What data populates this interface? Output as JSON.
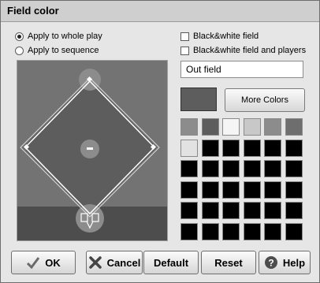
{
  "dialog": {
    "title": "Field color"
  },
  "apply": {
    "options": [
      {
        "label": "Apply to whole play",
        "selected": true
      },
      {
        "label": "Apply to sequence",
        "selected": false
      }
    ]
  },
  "options": {
    "bw_field": {
      "label": "Black&white field",
      "checked": false
    },
    "bw_field_players": {
      "label": "Black&white field and players",
      "checked": false
    }
  },
  "color_name": "Out field",
  "current_color": "#5d5d5d",
  "more_colors_label": "More Colors",
  "palette": [
    [
      "#8c8c8c",
      "#5d5d5d",
      "#f5f5f5",
      "#c8c8c8",
      "#8c8c8c",
      "#6e6e6e"
    ],
    [
      "#e2e2e2",
      "#000000",
      "#000000",
      "#000000",
      "#000000",
      "#000000"
    ],
    [
      "#000000",
      "#000000",
      "#000000",
      "#000000",
      "#000000",
      "#000000"
    ],
    [
      "#000000",
      "#000000",
      "#000000",
      "#000000",
      "#000000",
      "#000000"
    ],
    [
      "#000000",
      "#000000",
      "#000000",
      "#000000",
      "#000000",
      "#000000"
    ],
    [
      "#000000",
      "#000000",
      "#000000",
      "#000000",
      "#000000",
      "#000000"
    ]
  ],
  "field_colors": {
    "background": "#4d4d4d",
    "outfield": "#737373",
    "infield": "#5d5d5d",
    "mound": "#8c8c8c",
    "lines": "#ffffff"
  },
  "buttons": {
    "ok": "OK",
    "cancel": "Cancel",
    "default": "Default",
    "reset": "Reset",
    "help": "Help"
  }
}
